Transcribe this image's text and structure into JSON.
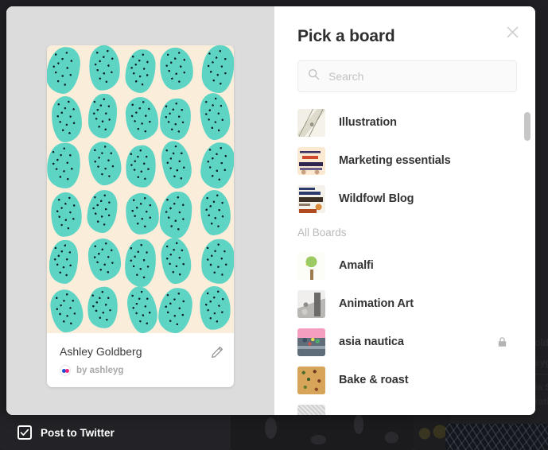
{
  "modal": {
    "title": "Pick a board",
    "close_icon": "close-x-icon",
    "search": {
      "placeholder": "Search",
      "value": "",
      "icon": "search-icon"
    },
    "suggested_boards": [
      {
        "name": "Illustration",
        "thumb": "th-illustration",
        "secret": false
      },
      {
        "name": "Marketing essentials",
        "thumb": "th-marketing",
        "secret": false
      },
      {
        "name": "Wildfowl Blog",
        "thumb": "th-wildfowl",
        "secret": false
      }
    ],
    "section_label": "All Boards",
    "all_boards": [
      {
        "name": "Amalfi",
        "thumb": "th-amalfi",
        "secret": false
      },
      {
        "name": "Animation Art",
        "thumb": "th-animation",
        "secret": false
      },
      {
        "name": "asia nautica",
        "thumb": "th-asia",
        "secret": true,
        "secret_icon": "lock-icon"
      },
      {
        "name": "Bake & roast",
        "thumb": "th-bake",
        "secret": false
      }
    ]
  },
  "preview": {
    "pin_title": "Ashley Goldberg",
    "attribution": "by ashleyg",
    "avatar_icon": "pinterest-avatar",
    "edit_icon": "pencil-edit-icon",
    "image_alt": "teal-leaf-pattern"
  },
  "bottom_bar": {
    "twitter_label": "Post to Twitter",
    "twitter_checked": true,
    "check_icon": "checkmark-icon"
  },
  "colors": {
    "modal_background": "#ffffff",
    "preview_background": "#dcdcdc",
    "pin_cream": "#faeedb",
    "pin_teal": "#5ed4c4",
    "pin_speckle": "#12242b",
    "overlay": "#1c1c1f",
    "text_primary": "#333333",
    "text_muted": "#b9b9b9",
    "scrollbar": "#c6c6c6",
    "avatar_blue": "#1a4fd8",
    "avatar_pink": "#f0267d"
  },
  "background_page": {
    "faint_texts": [
      "oldb",
      "eyg",
      "ia S",
      "ratio"
    ]
  }
}
